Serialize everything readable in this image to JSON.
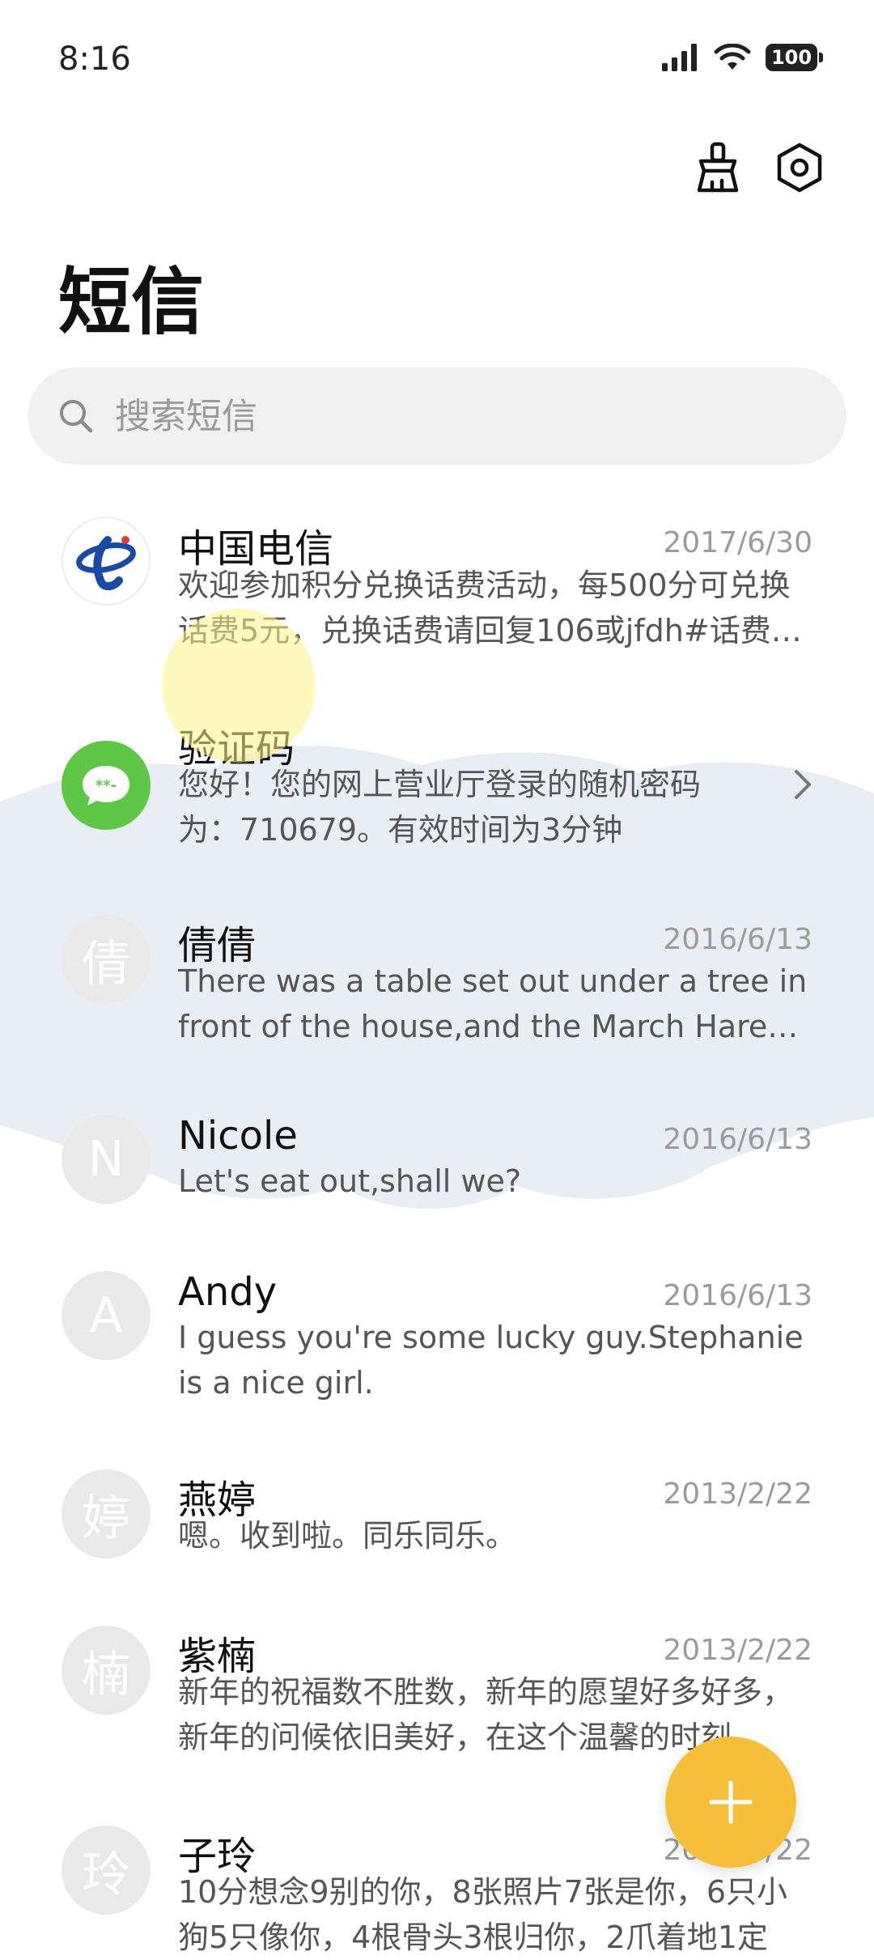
{
  "status_bar": {
    "time": "8:16",
    "battery": "100",
    "icons": [
      "signal-icon",
      "wifi-icon",
      "battery-icon"
    ]
  },
  "header": {
    "title": "短信",
    "actions": [
      "cleanup-brush-icon",
      "settings-icon"
    ]
  },
  "search": {
    "placeholder": "搜索短信"
  },
  "conversations": [
    {
      "name": "中国电信",
      "date": "2017/6/30",
      "preview": "欢迎参加积分兑换话费活动，每500分可兑换话费5元，兑换话费请回复106或jfdh#话费…",
      "avatar": "china-telecom-logo"
    },
    {
      "name": "验证码",
      "date": "",
      "preview": "您好！您的网上营业厅登录的随机密码为：710679。有效时间为3分钟",
      "avatar": "sms-bubble-icon",
      "avatar_text": "**-"
    },
    {
      "name": "倩倩",
      "date": "2016/6/13",
      "preview": "There was a table set out under a tree in front of the house,and the March Hare an…",
      "avatar_letter": "倩"
    },
    {
      "name": "Nicole",
      "date": "2016/6/13",
      "preview": "Let's eat out,shall we?",
      "avatar_letter": "N"
    },
    {
      "name": "Andy",
      "date": "2016/6/13",
      "preview": "I guess you're some lucky guy.Stephanie is a nice girl.",
      "avatar_letter": "A"
    },
    {
      "name": "燕婷",
      "date": "2013/2/22",
      "preview": "嗯。收到啦。同乐同乐。",
      "avatar_letter": "婷"
    },
    {
      "name": "紫楠",
      "date": "2013/2/22",
      "preview": "新年的祝福数不胜数，新年的愿望好多好多，新年的问候依旧美好，在这个温馨的时刻…",
      "avatar_letter": "楠"
    },
    {
      "name": "子玲",
      "date": "2013/2/22",
      "preview": "10分想念9别的你，8张照片7张是你，6只小狗5只像你，4根骨头3根归你，2爪着地1定",
      "avatar_letter": "玲"
    }
  ],
  "fab": {
    "icon": "plus-icon",
    "color": "#f5bf3a"
  }
}
